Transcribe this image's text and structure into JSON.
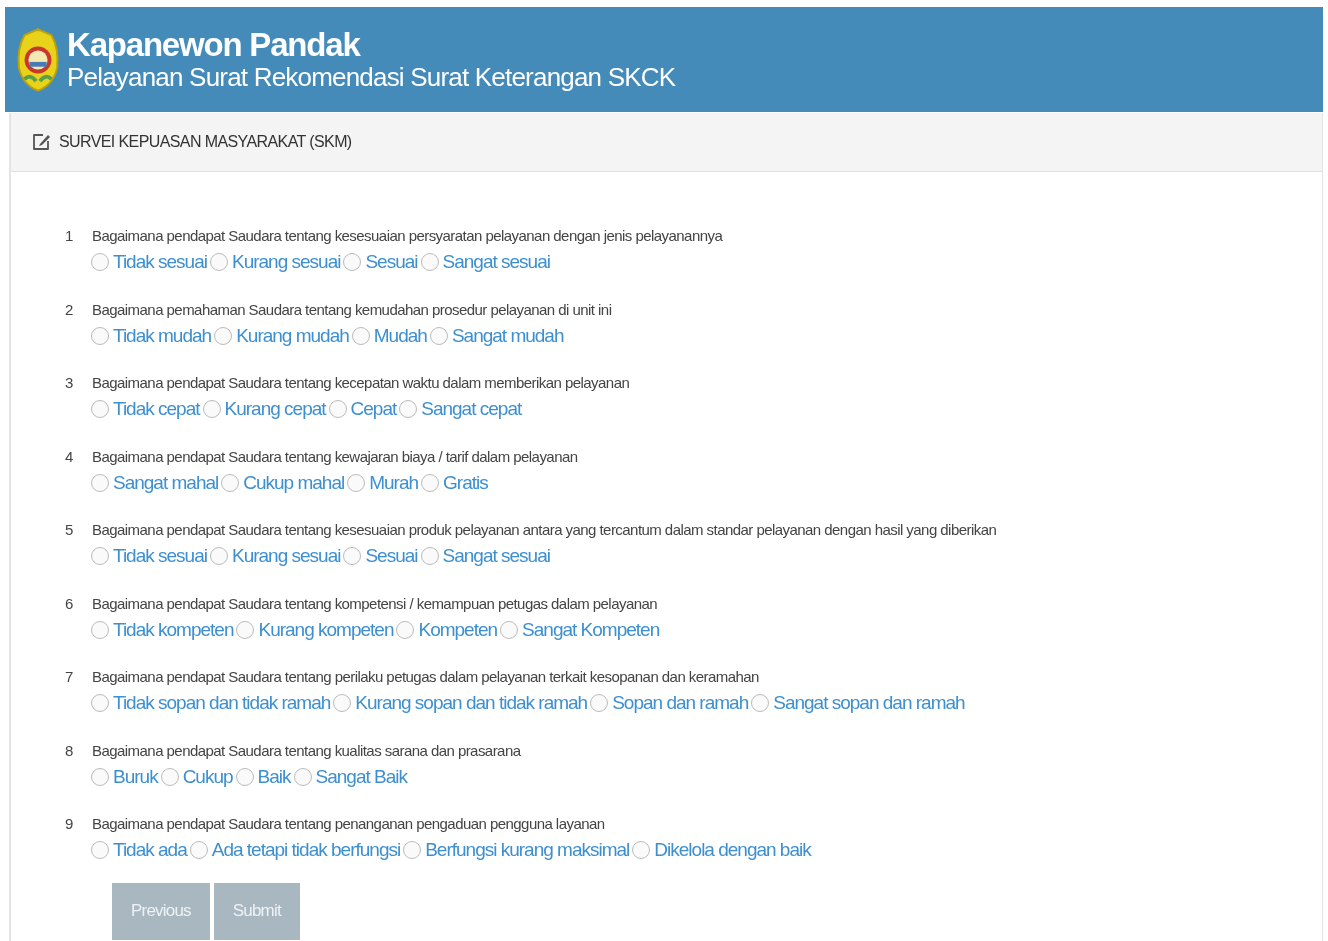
{
  "header": {
    "title": "Kapanewon Pandak",
    "subtitle": "Pelayanan Surat Rekomendasi Surat Keterangan SKCK"
  },
  "panel": {
    "heading": "SURVEI KEPUASAN MASYARAKAT (SKM)"
  },
  "questions": [
    {
      "number": "1",
      "text": "Bagaimana pendapat Saudara tentang kesesuaian persyaratan pelayanan dengan jenis pelayanannya",
      "options": [
        {
          "label": "Tidak sesuai",
          "selected": false
        },
        {
          "label": "Kurang sesuai",
          "selected": false
        },
        {
          "label": "Sesuai",
          "selected": false
        },
        {
          "label": "Sangat sesuai",
          "selected": false
        }
      ]
    },
    {
      "number": "2",
      "text": "Bagaimana pemahaman Saudara tentang kemudahan prosedur pelayanan di unit ini",
      "options": [
        {
          "label": "Tidak mudah",
          "selected": false
        },
        {
          "label": "Kurang mudah",
          "selected": false
        },
        {
          "label": "Mudah",
          "selected": false
        },
        {
          "label": "Sangat mudah",
          "selected": false
        }
      ]
    },
    {
      "number": "3",
      "text": "Bagaimana pendapat Saudara tentang kecepatan waktu dalam memberikan pelayanan",
      "options": [
        {
          "label": "Tidak cepat",
          "selected": false
        },
        {
          "label": "Kurang cepat",
          "selected": false
        },
        {
          "label": "Cepat",
          "selected": false
        },
        {
          "label": "Sangat cepat",
          "selected": false
        }
      ]
    },
    {
      "number": "4",
      "text": "Bagaimana pendapat Saudara tentang kewajaran biaya / tarif dalam pelayanan",
      "options": [
        {
          "label": "Sangat mahal",
          "selected": false
        },
        {
          "label": "Cukup mahal",
          "selected": false
        },
        {
          "label": "Murah",
          "selected": false
        },
        {
          "label": "Gratis",
          "selected": false
        }
      ]
    },
    {
      "number": "5",
      "text": "Bagaimana pendapat Saudara tentang kesesuaian produk pelayanan antara yang tercantum dalam standar pelayanan dengan hasil yang diberikan",
      "options": [
        {
          "label": "Tidak sesuai",
          "selected": false
        },
        {
          "label": "Kurang sesuai",
          "selected": false
        },
        {
          "label": "Sesuai",
          "selected": false
        },
        {
          "label": "Sangat sesuai",
          "selected": false
        }
      ]
    },
    {
      "number": "6",
      "text": "Bagaimana pendapat Saudara tentang kompetensi / kemampuan petugas dalam pelayanan",
      "options": [
        {
          "label": "Tidak kompeten",
          "selected": false
        },
        {
          "label": "Kurang kompeten",
          "selected": false
        },
        {
          "label": "Kompeten",
          "selected": false
        },
        {
          "label": "Sangat Kompeten",
          "selected": false
        }
      ]
    },
    {
      "number": "7",
      "text": "Bagaimana pendapat Saudara tentang perilaku petugas dalam pelayanan terkait kesopanan dan keramahan",
      "options": [
        {
          "label": "Tidak sopan dan tidak ramah",
          "selected": false
        },
        {
          "label": "Kurang sopan dan tidak ramah",
          "selected": false
        },
        {
          "label": "Sopan dan ramah",
          "selected": false
        },
        {
          "label": "Sangat sopan dan ramah",
          "selected": false
        }
      ]
    },
    {
      "number": "8",
      "text": "Bagaimana pendapat Saudara tentang kualitas sarana dan prasarana",
      "options": [
        {
          "label": "Buruk",
          "selected": false
        },
        {
          "label": "Cukup",
          "selected": false
        },
        {
          "label": "Baik",
          "selected": false
        },
        {
          "label": "Sangat Baik",
          "selected": false
        }
      ]
    },
    {
      "number": "9",
      "text": "Bagaimana pendapat Saudara tentang penanganan pengaduan pengguna layanan",
      "options": [
        {
          "label": "Tidak ada",
          "selected": false
        },
        {
          "label": "Ada tetapi tidak berfungsi",
          "selected": false
        },
        {
          "label": "Berfungsi kurang maksimal",
          "selected": false
        },
        {
          "label": "Dikelola dengan baik",
          "selected": false
        }
      ]
    }
  ],
  "buttons": [
    {
      "label": "Previous",
      "disabled": true
    },
    {
      "label": "Submit",
      "disabled": true
    }
  ]
}
